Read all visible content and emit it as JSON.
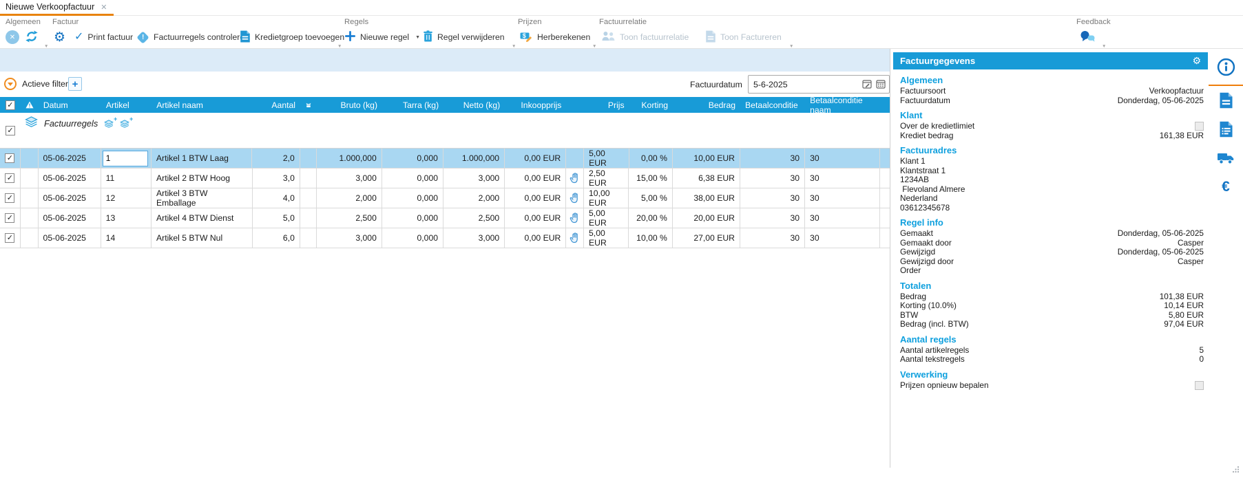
{
  "tab": {
    "title": "Nieuwe Verkoopfactuur"
  },
  "glyphs": {
    "close": "✕",
    "gear": "⚙",
    "check": "✓",
    "euro": "€",
    "caret": "▼"
  },
  "colors": {
    "accent_blue": "#189bd7",
    "selected_row": "#a9d7f2",
    "accent_orange": "#e8830c",
    "heading_blue": "#0fa0de"
  },
  "ribbon": {
    "algemeen": {
      "label": "Algemeen"
    },
    "factuur": {
      "label": "Factuur",
      "print": "Print factuur",
      "controleren": "Factuurregels controleren",
      "kredietgroep": "Kredietgroep toevoegen"
    },
    "regels": {
      "label": "Regels",
      "nieuwe": "Nieuwe regel",
      "verwijderen": "Regel verwijderen"
    },
    "prijzen": {
      "label": "Prijzen",
      "herberekenen": "Herberekenen"
    },
    "relatie": {
      "label": "Factuurrelatie",
      "toon_relatie": "Toon factuurrelatie",
      "toon_factureren": "Toon Factureren"
    },
    "feedback": {
      "label": "Feedback"
    }
  },
  "filters": {
    "label": "Actieve filters:",
    "add": "+"
  },
  "factuurdatum": {
    "label": "Factuurdatum",
    "value": "5-6-2025"
  },
  "grid": {
    "columns": [
      {
        "key": "sel",
        "label": "",
        "type": "checkbox"
      },
      {
        "key": "warn",
        "label": "",
        "type": "warning"
      },
      {
        "key": "datum",
        "label": "Datum",
        "align": "left"
      },
      {
        "key": "artikel",
        "label": "Artikel",
        "align": "left"
      },
      {
        "key": "artikel_naam",
        "label": "Artikel naam",
        "align": "left"
      },
      {
        "key": "aantal",
        "label": "Aantal",
        "align": "right"
      },
      {
        "key": "scale",
        "label": "",
        "type": "scale"
      },
      {
        "key": "bruto",
        "label": "Bruto (kg)",
        "align": "right"
      },
      {
        "key": "tarra",
        "label": "Tarra (kg)",
        "align": "right"
      },
      {
        "key": "netto",
        "label": "Netto (kg)",
        "align": "right"
      },
      {
        "key": "inkoopprijs",
        "label": "Inkoopprijs",
        "align": "right"
      },
      {
        "key": "hand",
        "label": "",
        "type": "hand"
      },
      {
        "key": "prijs",
        "label": "Prijs",
        "align": "right"
      },
      {
        "key": "korting",
        "label": "Korting",
        "align": "right"
      },
      {
        "key": "bedrag",
        "label": "Bedrag",
        "align": "right"
      },
      {
        "key": "betaalconditie",
        "label": "Betaalconditie",
        "align": "left",
        "cell_align": "right"
      },
      {
        "key": "betaalconditie_naam",
        "label": "Betaalconditie naam",
        "align": "left"
      }
    ],
    "group_row": {
      "label": "Factuurregels"
    },
    "rows": [
      {
        "checked": true,
        "selected": true,
        "editing": true,
        "datum": "05-06-2025",
        "artikel": "1",
        "artikel_naam": "Artikel 1 BTW Laag",
        "aantal": "2,0",
        "bruto": "1.000,000",
        "tarra": "0,000",
        "netto": "1.000,000",
        "inkoopprijs": "0,00 EUR",
        "hand": false,
        "prijs": "5,00 EUR",
        "korting": "0,00 %",
        "bedrag": "10,00 EUR",
        "betaalconditie": "30",
        "betaalconditie_naam": "30"
      },
      {
        "checked": true,
        "selected": false,
        "editing": false,
        "datum": "05-06-2025",
        "artikel": "11",
        "artikel_naam": "Artikel 2 BTW Hoog",
        "aantal": "3,0",
        "bruto": "3,000",
        "tarra": "0,000",
        "netto": "3,000",
        "inkoopprijs": "0,00 EUR",
        "hand": true,
        "prijs": "2,50 EUR",
        "korting": "15,00 %",
        "bedrag": "6,38 EUR",
        "betaalconditie": "30",
        "betaalconditie_naam": "30"
      },
      {
        "checked": true,
        "selected": false,
        "editing": false,
        "datum": "05-06-2025",
        "artikel": "12",
        "artikel_naam": "Artikel 3 BTW Emballage",
        "aantal": "4,0",
        "bruto": "2,000",
        "tarra": "0,000",
        "netto": "2,000",
        "inkoopprijs": "0,00 EUR",
        "hand": true,
        "prijs": "10,00 EUR",
        "korting": "5,00 %",
        "bedrag": "38,00 EUR",
        "betaalconditie": "30",
        "betaalconditie_naam": "30"
      },
      {
        "checked": true,
        "selected": false,
        "editing": false,
        "datum": "05-06-2025",
        "artikel": "13",
        "artikel_naam": "Artikel 4 BTW Dienst",
        "aantal": "5,0",
        "bruto": "2,500",
        "tarra": "0,000",
        "netto": "2,500",
        "inkoopprijs": "0,00 EUR",
        "hand": true,
        "prijs": "5,00 EUR",
        "korting": "20,00 %",
        "bedrag": "20,00 EUR",
        "betaalconditie": "30",
        "betaalconditie_naam": "30"
      },
      {
        "checked": true,
        "selected": false,
        "editing": false,
        "datum": "05-06-2025",
        "artikel": "14",
        "artikel_naam": "Artikel 5 BTW Nul",
        "aantal": "6,0",
        "bruto": "3,000",
        "tarra": "0,000",
        "netto": "3,000",
        "inkoopprijs": "0,00 EUR",
        "hand": true,
        "prijs": "5,00 EUR",
        "korting": "10,00 %",
        "bedrag": "27,00 EUR",
        "betaalconditie": "30",
        "betaalconditie_naam": "30"
      }
    ]
  },
  "panel": {
    "title": "Factuurgegevens",
    "sections": [
      {
        "heading": "Algemeen",
        "rows": [
          {
            "label": "Factuursoort",
            "value": "Verkoopfactuur"
          },
          {
            "label": "Factuurdatum",
            "value": "Donderdag, 05-06-2025"
          }
        ]
      },
      {
        "heading": "Klant",
        "rows": [
          {
            "label": "Over de kredietlimiet",
            "checkbox": true
          },
          {
            "label": "Krediet bedrag",
            "value": "161,38 EUR"
          }
        ]
      },
      {
        "heading": "Factuuradres",
        "rows": [
          {
            "label": "Klant 1",
            "value": ""
          },
          {
            "label": "Klantstraat 1",
            "value": ""
          },
          {
            "label": "1234AB",
            "value": ""
          },
          {
            "label": " Flevoland Almere",
            "value": ""
          },
          {
            "label": "Nederland",
            "value": ""
          },
          {
            "label": "03612345678",
            "value": ""
          }
        ]
      },
      {
        "heading": "Regel info",
        "rows": [
          {
            "label": "Gemaakt",
            "value": "Donderdag, 05-06-2025"
          },
          {
            "label": "Gemaakt door",
            "value": "Casper"
          },
          {
            "label": "Gewijzigd",
            "value": "Donderdag, 05-06-2025"
          },
          {
            "label": "Gewijzigd door",
            "value": "Casper"
          },
          {
            "label": "Order",
            "value": ""
          }
        ]
      },
      {
        "heading": "Totalen",
        "rows": [
          {
            "label": "Bedrag",
            "value": "101,38 EUR"
          },
          {
            "label": "Korting (10.0%)",
            "value": "10,14 EUR"
          },
          {
            "label": "BTW",
            "value": "5,80 EUR"
          },
          {
            "label": "Bedrag (incl. BTW)",
            "value": "97,04 EUR"
          }
        ]
      },
      {
        "heading": "Aantal regels",
        "rows": [
          {
            "label": "Aantal artikelregels",
            "value": "5"
          },
          {
            "label": "Aantal tekstregels",
            "value": "0"
          }
        ]
      },
      {
        "heading": "Verwerking",
        "rows": [
          {
            "label": "Prijzen opnieuw bepalen",
            "checkbox": true
          }
        ]
      }
    ]
  },
  "side_strip": {
    "icons": [
      {
        "name": "info-icon",
        "selected": true
      },
      {
        "name": "document-icon",
        "selected": false
      },
      {
        "name": "document-lines-icon",
        "selected": false
      },
      {
        "name": "delivery-truck-icon",
        "selected": false
      },
      {
        "name": "euro-icon",
        "selected": false
      }
    ]
  }
}
